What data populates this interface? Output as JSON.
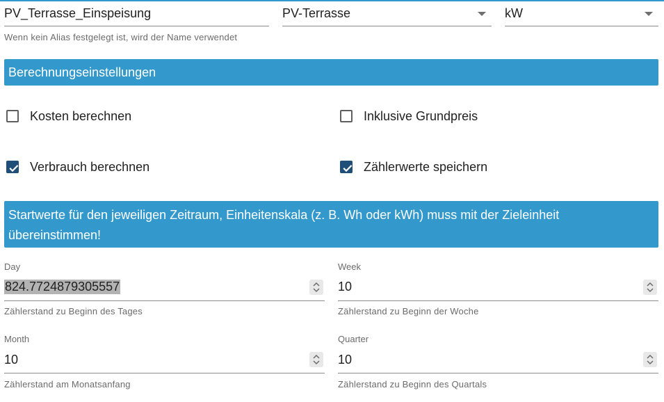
{
  "alias": {
    "value": "PV_Terrasse_Einspeisung",
    "hint": "Wenn kein Alias festgelegt ist, wird der Name verwendet"
  },
  "device_select": {
    "value": "PV-Terrasse"
  },
  "unit_select": {
    "value": "kW"
  },
  "calc_settings": {
    "title": "Berechnungseinstellungen",
    "options": [
      {
        "label": "Kosten berechnen",
        "checked": false
      },
      {
        "label": "Inklusive Grundpreis",
        "checked": false
      },
      {
        "label": "Verbrauch berechnen",
        "checked": true
      },
      {
        "label": "Zählerwerte speichern",
        "checked": true
      }
    ]
  },
  "start_values": {
    "title": "Startwerte für den jeweiligen Zeitraum, Einheitenskala (z. B. Wh oder kWh) muss mit der Zieleinheit übereinstimmen!",
    "fields": [
      {
        "label": "Day",
        "value": "824.7724879305557",
        "hint": "Zählerstand zu Beginn des Tages"
      },
      {
        "label": "Week",
        "value": "10",
        "hint": "Zählerstand zu Beginn der Woche"
      },
      {
        "label": "Month",
        "value": "10",
        "hint": "Zählerstand am Monatsanfang"
      },
      {
        "label": "Quarter",
        "value": "10",
        "hint": "Zählerstand zu Beginn des Quartals"
      }
    ]
  },
  "colors": {
    "accent": "#3399cc",
    "checkbox_checked": "#1f4e79"
  },
  "icons": [
    "dropdown-arrow-icon",
    "checkmark-icon",
    "spinner-icon"
  ]
}
